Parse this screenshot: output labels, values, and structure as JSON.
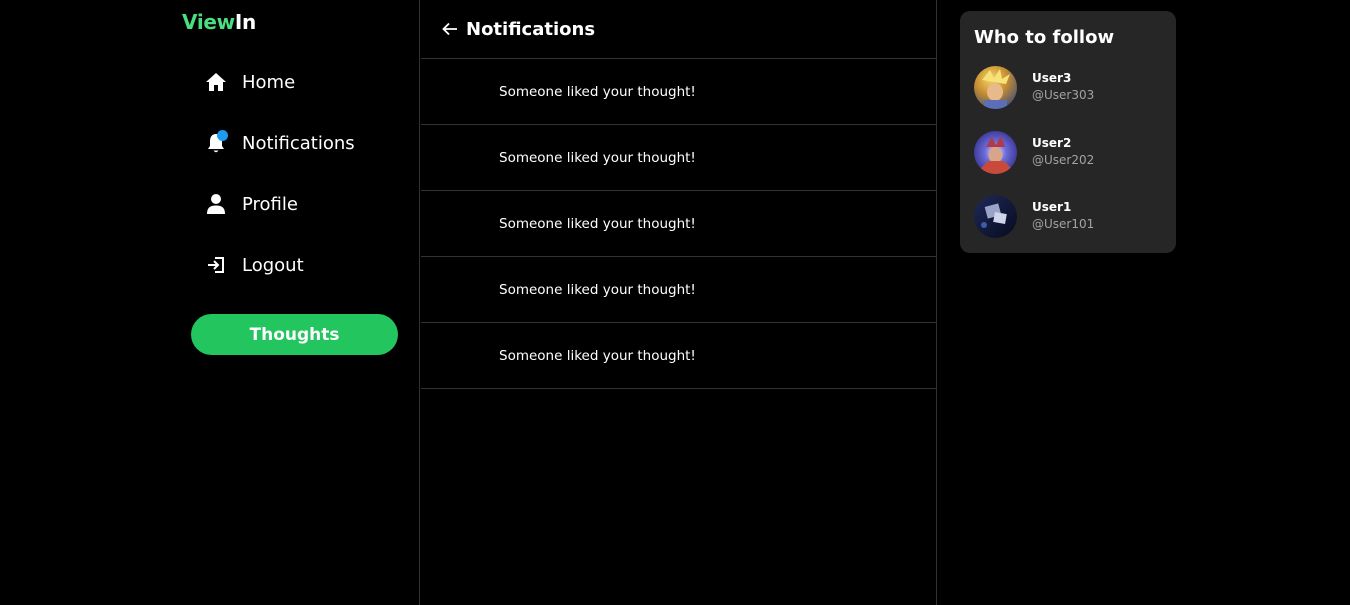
{
  "app": {
    "logo_part1": "View",
    "logo_part2": "In"
  },
  "sidebar": {
    "items": [
      {
        "label": "Home",
        "icon": "home-icon"
      },
      {
        "label": "Notifications",
        "icon": "bell-icon",
        "has_unread_dot": true
      },
      {
        "label": "Profile",
        "icon": "user-icon"
      },
      {
        "label": "Logout",
        "icon": "logout-icon"
      }
    ],
    "primary_button": "Thoughts"
  },
  "main": {
    "title": "Notifications",
    "notifications": [
      "Someone liked your thought!",
      "Someone liked your thought!",
      "Someone liked your thought!",
      "Someone liked your thought!",
      "Someone liked your thought!"
    ]
  },
  "who_to_follow": {
    "title": "Who to follow",
    "users": [
      {
        "name": "User3",
        "handle": "@User303"
      },
      {
        "name": "User2",
        "handle": "@User202"
      },
      {
        "name": "User1",
        "handle": "@User101"
      }
    ]
  },
  "colors": {
    "background": "#000000",
    "accent_green": "#22c55e",
    "logo_green": "#4ade80",
    "notification_dot": "#1d9bf0",
    "card_background": "#262626",
    "divider": "#2f3336"
  }
}
